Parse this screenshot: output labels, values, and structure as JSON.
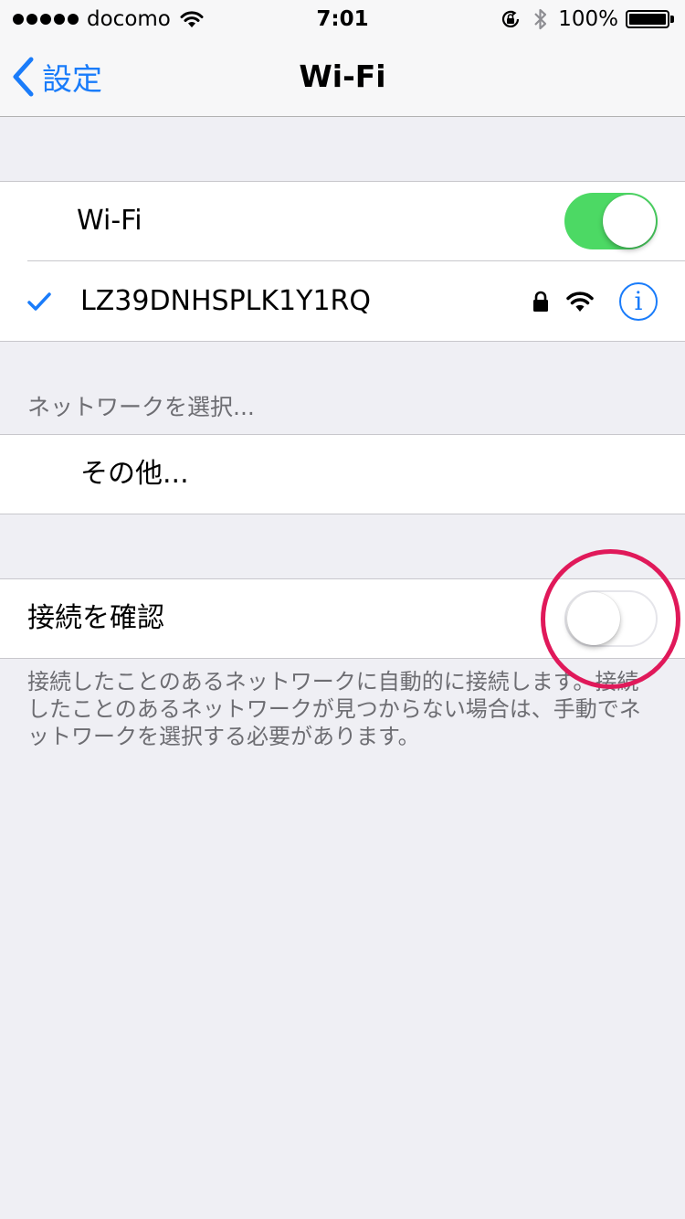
{
  "status_bar": {
    "signal_bars": 5,
    "carrier": "docomo",
    "time": "7:01",
    "battery_percent": "100%",
    "icons": [
      "wifi-icon",
      "rotation-lock-icon",
      "bluetooth-icon",
      "battery-icon"
    ]
  },
  "nav": {
    "back_label": "設定",
    "title": "Wi-Fi"
  },
  "wifi_section": {
    "toggle_label": "Wi-Fi",
    "toggle_on": true,
    "network_name": "LZ39DNHSPLK1Y1RQ",
    "network_connected": true,
    "network_icons": [
      "checkmark-icon",
      "lock-icon",
      "wifi-strength-icon",
      "info-icon"
    ],
    "info_glyph": "i"
  },
  "networks_section": {
    "header": "ネットワークを選択...",
    "other_label": "その他..."
  },
  "ask_section": {
    "toggle_label": "接続を確認",
    "toggle_on": false,
    "footer": "接続したことのあるネットワークに自動的に接続します。接続したことのあるネットワークが見つからない場合は、手動でネットワークを選択する必要があります。"
  },
  "colors": {
    "accent": "#1a7cfa",
    "switch_on": "#4cd964",
    "background": "#efeff4",
    "highlight_ring": "#e0195a"
  }
}
